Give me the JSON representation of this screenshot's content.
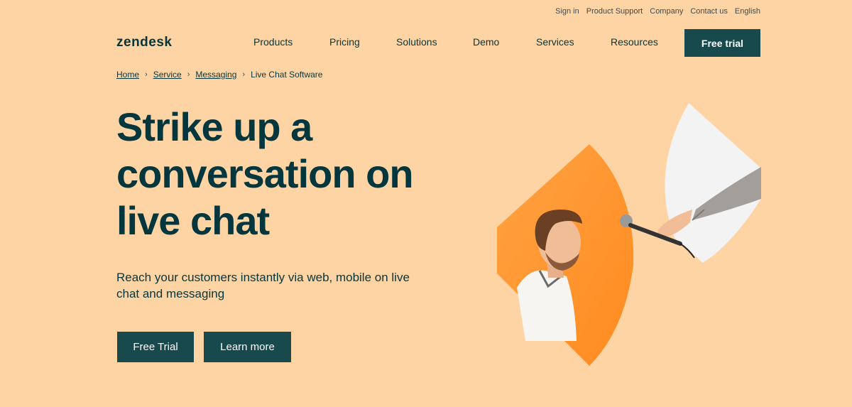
{
  "utility_nav": [
    "Sign in",
    "Product Support",
    "Company",
    "Contact us",
    "English"
  ],
  "logo": "zendesk",
  "main_nav": [
    "Products",
    "Pricing",
    "Solutions",
    "Demo",
    "Services",
    "Resources"
  ],
  "header_cta": "Free trial",
  "breadcrumb": {
    "items": [
      "Home",
      "Service",
      "Messaging"
    ],
    "current": "Live Chat Software"
  },
  "hero": {
    "title": "Strike up a conversation on live chat",
    "subtitle": "Reach your customers instantly via web, mobile on live chat and messaging",
    "primary_cta": "Free Trial",
    "secondary_cta": "Learn more"
  },
  "colors": {
    "background": "#ffd4a5",
    "brand_dark": "#03363d",
    "button": "#17494d",
    "accent_orange": "#ff9b3d"
  }
}
